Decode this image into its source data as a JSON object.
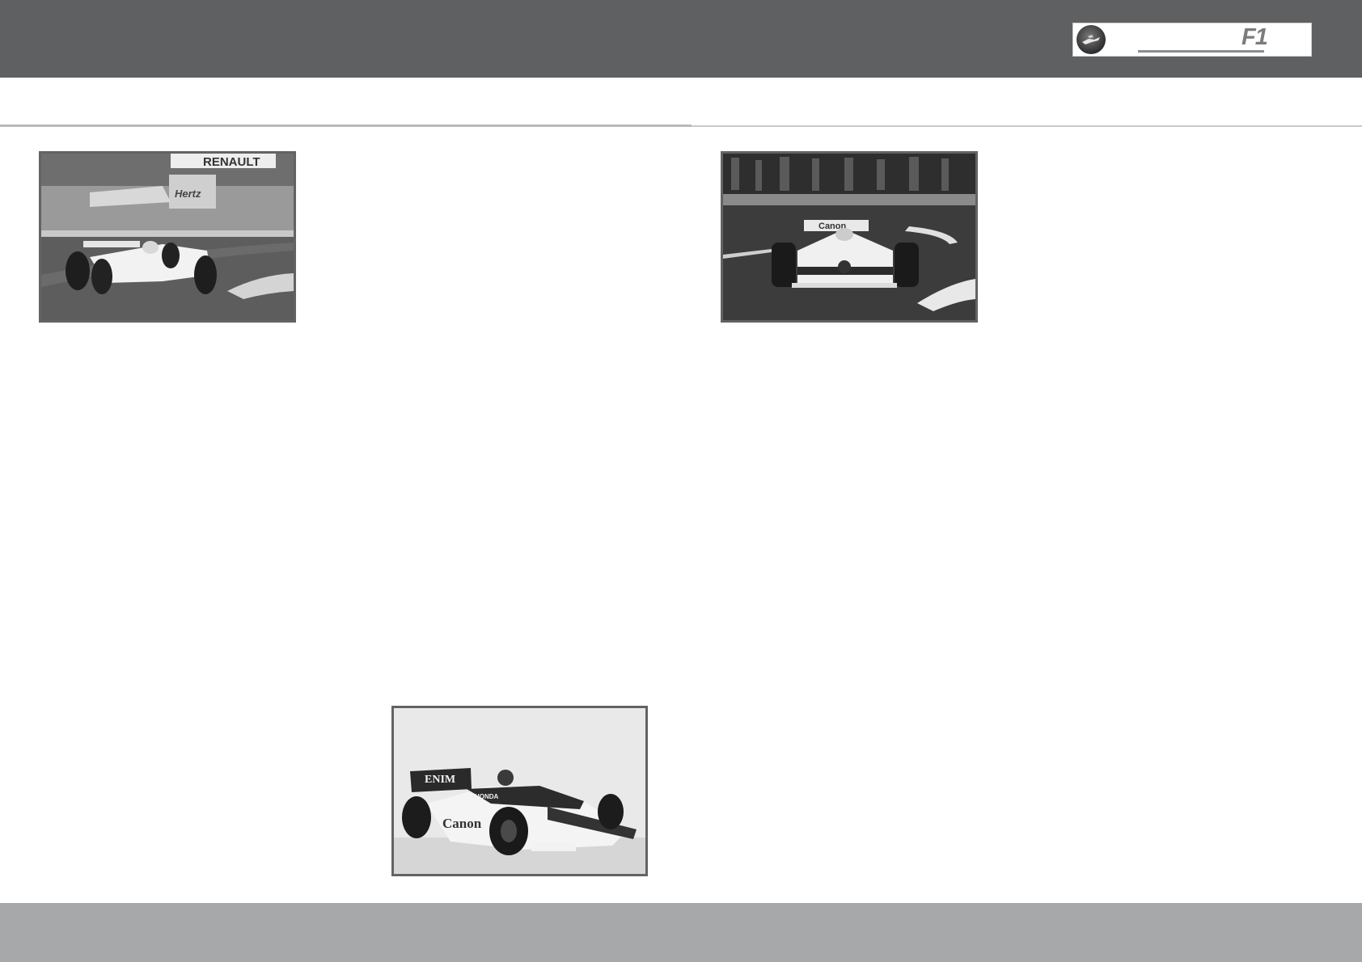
{
  "header": {
    "logo": {
      "icon": "helmet-emblem-icon",
      "text": "F1"
    }
  },
  "photos": [
    {
      "name": "williams-fw07-photo",
      "signage": [
        "RENAULT",
        "Hertz"
      ]
    },
    {
      "name": "williams-fw11-action-photo",
      "signage": [
        "Canon"
      ]
    },
    {
      "name": "williams-fw11-studio-photo",
      "signage": [
        "Canon",
        "HONDA"
      ]
    }
  ],
  "colors": {
    "header": "#5f6062",
    "footer": "#a7a8aa",
    "rule": "#b9b9b9",
    "photo_border": "#636365"
  }
}
